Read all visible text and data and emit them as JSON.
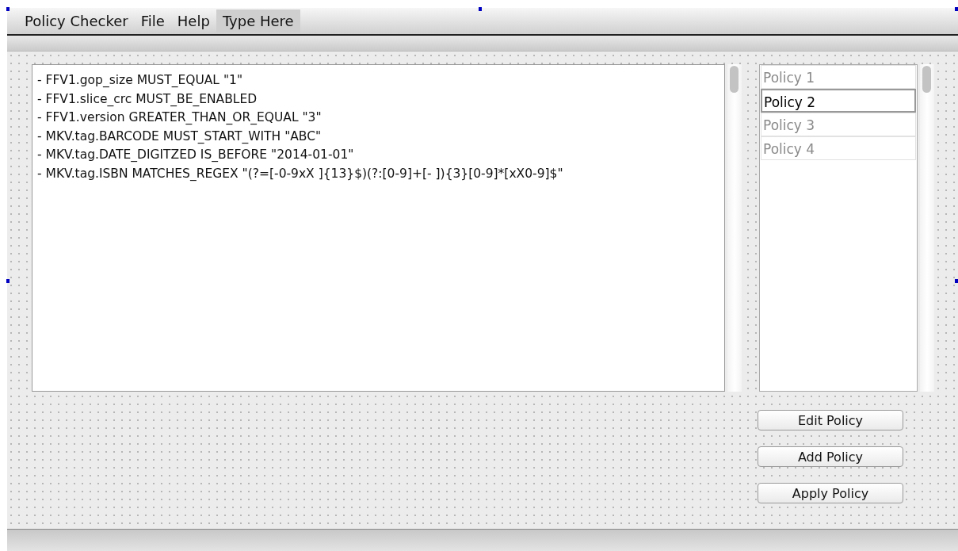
{
  "menu_bar": {
    "items": [
      {
        "label": "Policy Checker",
        "selected": false
      },
      {
        "label": "File",
        "selected": false
      },
      {
        "label": "Help",
        "selected": false
      },
      {
        "label": "Type Here",
        "selected": true
      }
    ]
  },
  "rules_text": {
    "lines": [
      "- FFV1.gop_size MUST_EQUAL \"1\"",
      "- FFV1.slice_crc MUST_BE_ENABLED",
      "- FFV1.version GREATER_THAN_OR_EQUAL \"3\"",
      "- MKV.tag.BARCODE MUST_START_WITH \"ABC\"",
      "- MKV.tag.DATE_DIGITZED IS_BEFORE \"2014-01-01\"",
      "- MKV.tag.ISBN MATCHES_REGEX \"(?=[-0-9xX ]{13}$)(?:[0-9]+[- ]){3}[0-9]*[xX0-9]$\""
    ]
  },
  "policy_list": {
    "items": [
      {
        "label": "Policy 1",
        "selected": false
      },
      {
        "label": "Policy 2",
        "selected": true
      },
      {
        "label": "Policy 3",
        "selected": false
      },
      {
        "label": "Policy 4",
        "selected": false
      }
    ]
  },
  "buttons": [
    "Edit Policy",
    "Add Policy",
    "Apply Policy"
  ]
}
